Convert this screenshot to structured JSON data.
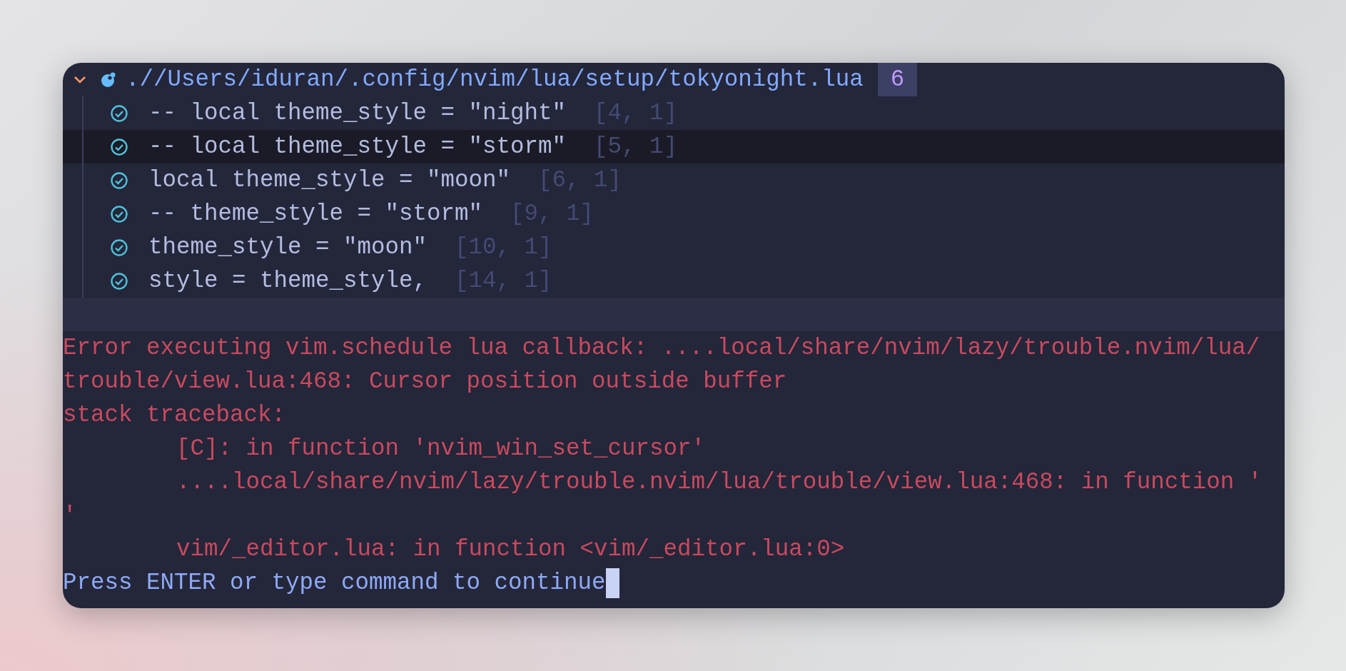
{
  "group": {
    "path": ".//Users/iduran/.config/nvim/lua/setup/tokyonight.lua",
    "count": "6",
    "expanded": true
  },
  "items": [
    {
      "text": "-- local theme_style = \"night\"",
      "position": "[4, 1]",
      "selected": false
    },
    {
      "text": "-- local theme_style = \"storm\"",
      "position": "[5, 1]",
      "selected": true
    },
    {
      "text": "local theme_style = \"moon\"",
      "position": "[6, 1]",
      "selected": false
    },
    {
      "text": "-- theme_style = \"storm\"",
      "position": "[9, 1]",
      "selected": false
    },
    {
      "text": "theme_style = \"moon\"",
      "position": "[10, 1]",
      "selected": false
    },
    {
      "text": "style = theme_style,",
      "position": "[14, 1]",
      "selected": false
    }
  ],
  "messages": [
    {
      "kind": "error",
      "text": "Error executing vim.schedule lua callback: ....local/share/nvim/lazy/trouble.nvim/lua/"
    },
    {
      "kind": "error",
      "text": "trouble/view.lua:468: Cursor position outside buffer"
    },
    {
      "kind": "error",
      "text": "stack traceback:"
    },
    {
      "kind": "trace",
      "text": "[C]: in function 'nvim_win_set_cursor'"
    },
    {
      "kind": "trace",
      "text": "....local/share/nvim/lazy/trouble.nvim/lua/trouble/view.lua:468: in function '"
    },
    {
      "kind": "error",
      "text": "'"
    },
    {
      "kind": "trace",
      "text": "vim/_editor.lua: in function <vim/_editor.lua:0>"
    },
    {
      "kind": "prompt",
      "text": "Press ENTER or type command to continue"
    }
  ]
}
